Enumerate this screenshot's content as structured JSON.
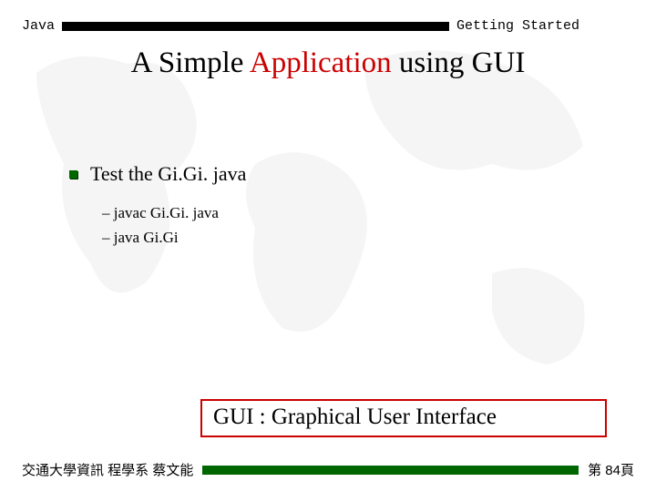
{
  "header": {
    "left": "Java",
    "right": "Getting Started"
  },
  "title": {
    "prefix": "A Simple ",
    "highlight": "Application",
    "suffix": " using GUI"
  },
  "main": {
    "bullet": "Test the Gi.Gi. java",
    "sub": [
      "javac Gi.Gi. java",
      "java  Gi.Gi"
    ]
  },
  "note": "GUI : Graphical User Interface",
  "footer": {
    "left": "交通大學資訊 程學系 蔡文能",
    "right": "第 84頁"
  }
}
